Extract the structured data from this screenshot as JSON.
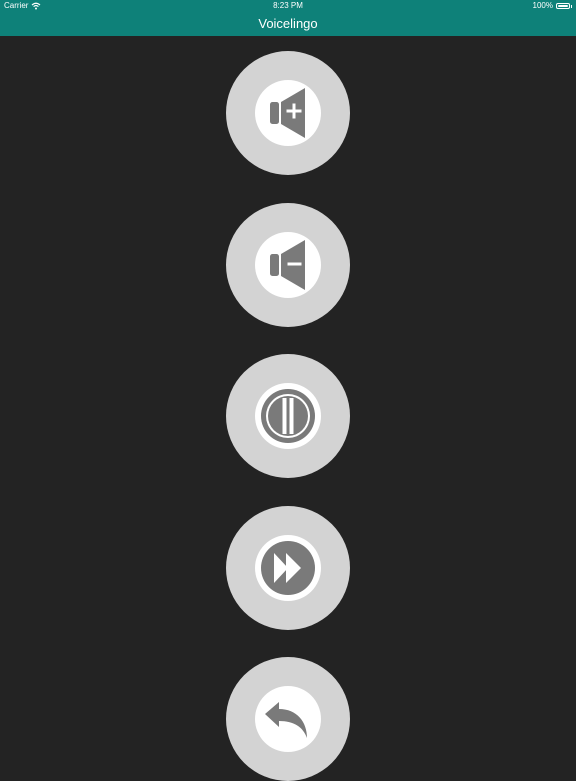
{
  "status_bar": {
    "carrier": "Carrier",
    "time": "8:23 PM",
    "battery": "100%"
  },
  "nav": {
    "title": "Voicelingo"
  },
  "controls": [
    {
      "name": "volume-up",
      "icon": "volume-plus-icon"
    },
    {
      "name": "volume-down",
      "icon": "volume-minus-icon"
    },
    {
      "name": "pause",
      "icon": "pause-icon"
    },
    {
      "name": "fast-forward",
      "icon": "fast-forward-icon"
    },
    {
      "name": "back",
      "icon": "reply-arrow-icon"
    }
  ],
  "colors": {
    "bar": "#0e8179",
    "background": "#232323",
    "button": "#d3d3d3",
    "icon": "#7a7a7a"
  }
}
